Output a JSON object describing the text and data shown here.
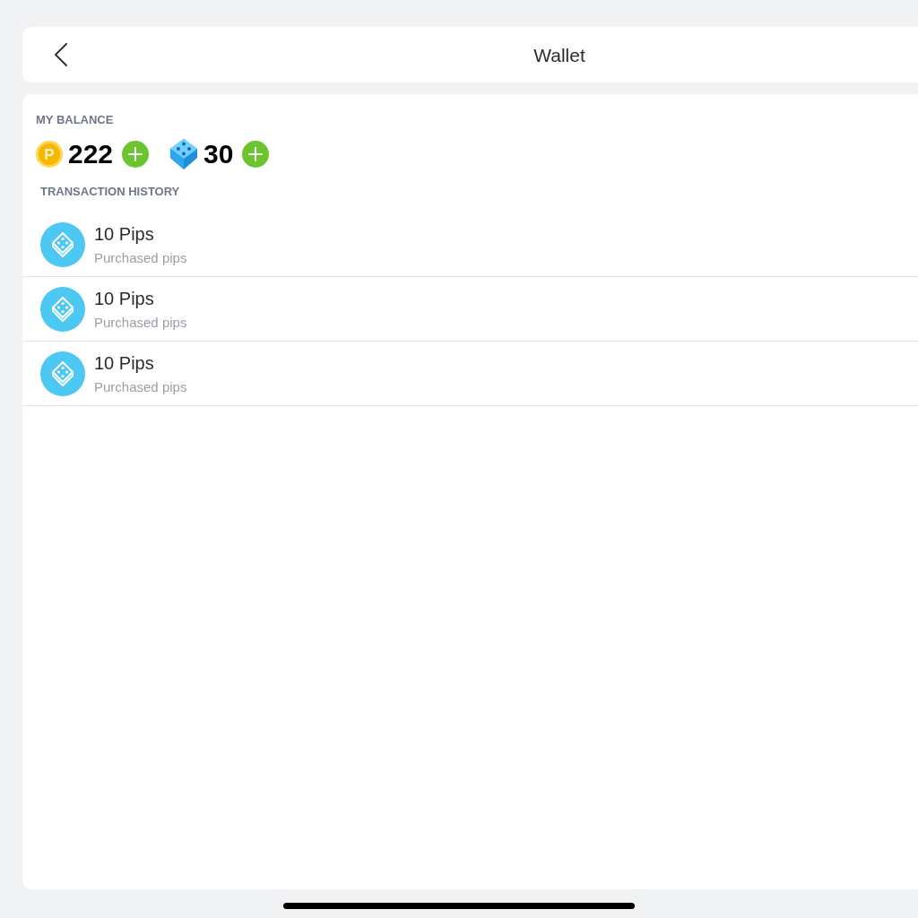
{
  "header": {
    "title": "Wallet"
  },
  "balance": {
    "label": "MY BALANCE",
    "currencies": [
      {
        "kind": "coin",
        "symbol": "P",
        "amount": "222"
      },
      {
        "kind": "pips",
        "amount": "30"
      }
    ]
  },
  "history": {
    "label": "TRANSACTION HISTORY",
    "transactions": [
      {
        "kind": "pips",
        "title": "10 Pips",
        "description": "Purchased pips"
      },
      {
        "kind": "pips",
        "title": "10 Pips",
        "description": "Purchased pips"
      },
      {
        "kind": "pips",
        "title": "10 Pips",
        "description": "Purchased pips"
      }
    ]
  }
}
